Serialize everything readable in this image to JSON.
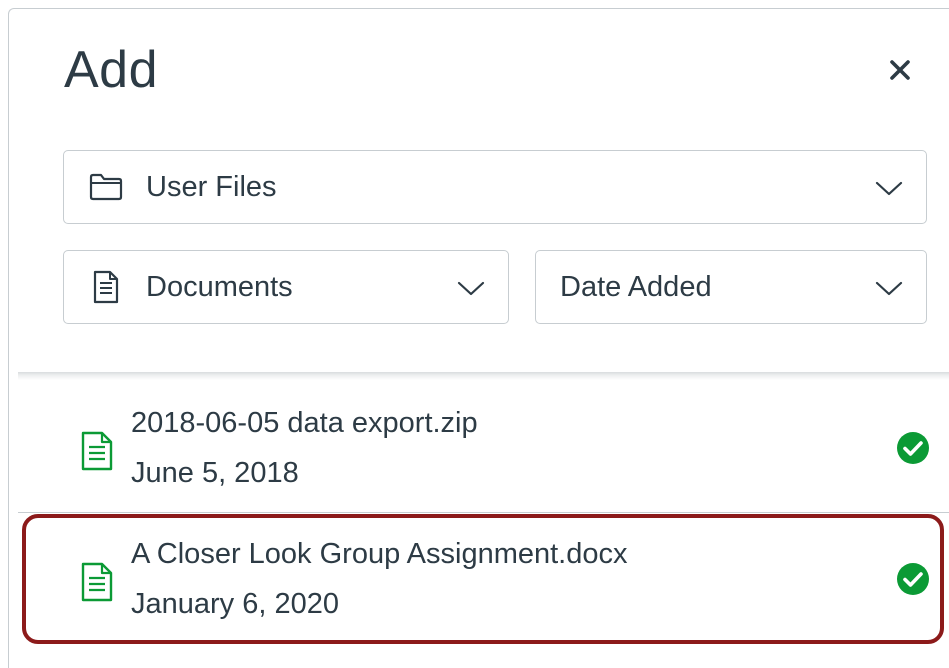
{
  "dialog": {
    "title": "Add",
    "close_icon": "close-icon"
  },
  "filters": {
    "source": {
      "label": "User Files",
      "icon": "folder-icon"
    },
    "type": {
      "label": "Documents",
      "icon": "document-icon"
    },
    "sort": {
      "label": "Date Added"
    }
  },
  "files": [
    {
      "name": "2018-06-05 data export.zip",
      "date": "June 5, 2018",
      "icon": "document-icon",
      "status": "check-icon"
    },
    {
      "name": "A Closer Look Group Assignment.docx",
      "date": "January 6, 2020",
      "icon": "document-icon",
      "status": "check-icon",
      "highlighted": true
    }
  ],
  "colors": {
    "text": "#2d3b45",
    "border": "#c7cdd1",
    "file_icon_green": "#0b9a35",
    "check_green": "#0b9a35",
    "highlight": "#8c1a1a"
  }
}
